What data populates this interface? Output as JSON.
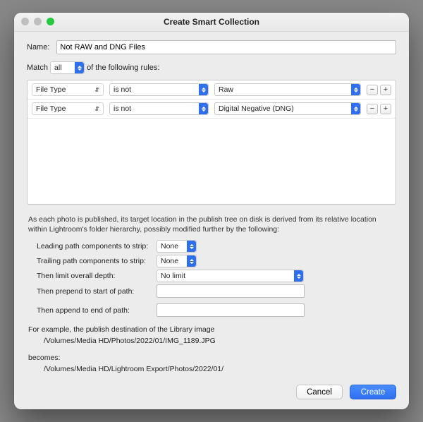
{
  "window": {
    "title": "Create Smart Collection"
  },
  "name_row": {
    "label": "Name:",
    "value": "Not RAW and DNG Files"
  },
  "match": {
    "prefix": "Match",
    "mode": "all",
    "suffix": "of the following rules:"
  },
  "rules": [
    {
      "attribute": "File Type",
      "operator": "is not",
      "value": "Raw"
    },
    {
      "attribute": "File Type",
      "operator": "is not",
      "value": "Digital Negative (DNG)"
    }
  ],
  "desc": "As each photo is published, its target location in the publish tree on disk is derived from its relative location within Lightroom's folder hierarchy, possibly modified further by the following:",
  "opts": {
    "leading": {
      "label": "Leading path components to strip:",
      "value": "None"
    },
    "trailing": {
      "label": "Trailing path components to strip:",
      "value": "None"
    },
    "depth": {
      "label": "Then limit overall depth:",
      "value": "No limit"
    },
    "prepend": {
      "label": "Then prepend to start of path:",
      "value": ""
    },
    "append": {
      "label": "Then append to end of path:",
      "value": ""
    }
  },
  "example": {
    "intro": "For example, the publish destination of the Library image",
    "src": "/Volumes/Media HD/Photos/2022/01/IMG_1189.JPG",
    "becomes_label": "becomes:",
    "dst": "/Volumes/Media HD/Lightroom Export/Photos/2022/01/"
  },
  "buttons": {
    "cancel": "Cancel",
    "create": "Create"
  },
  "pm": {
    "minus": "−",
    "plus": "+"
  }
}
